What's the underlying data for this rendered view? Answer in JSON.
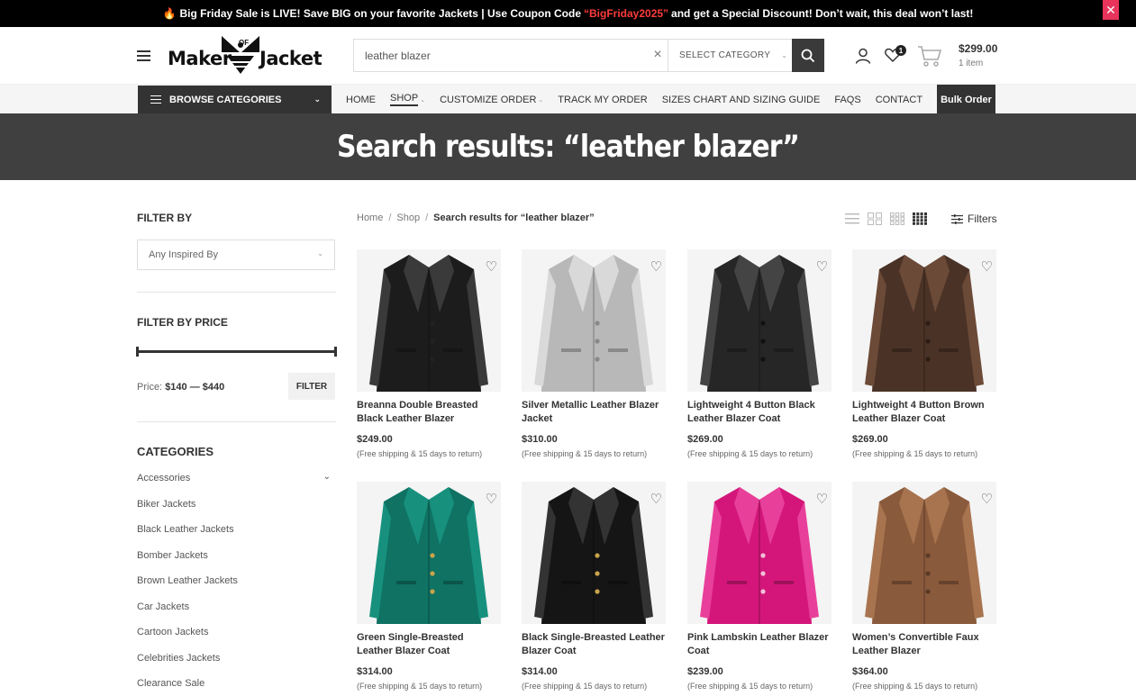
{
  "promo": {
    "icon": "fire-icon",
    "text_before": "Big Friday Sale is LIVE! Save BIG on your favorite Jackets | Use Coupon Code",
    "coupon": "“BigFriday2025”",
    "text_after": "and get a Special Discount! Don’t wait, this deal won’t last!",
    "coupon_color": "#ff3b3b"
  },
  "header": {
    "logo": {
      "word1": "Maker",
      "of": "OF",
      "word2": "Jacket"
    },
    "search": {
      "value": "leather blazer",
      "category": "SELECT CATEGORY"
    },
    "cart": {
      "total": "$299.00",
      "items": "1 item"
    },
    "wishlist_count": "1"
  },
  "nav": {
    "browse_label": "BROWSE CATEGORIES",
    "links": [
      {
        "label": "HOME"
      },
      {
        "label": "SHOP"
      },
      {
        "label": "CUSTOMIZE ORDER"
      },
      {
        "label": "TRACK MY ORDER"
      },
      {
        "label": "SIZES CHART AND SIZING GUIDE"
      },
      {
        "label": "FAQS"
      },
      {
        "label": "CONTACT"
      }
    ],
    "bulk_label": "Bulk Order"
  },
  "banner": {
    "title": "Search results: “leather blazer”"
  },
  "sidebar": {
    "filter_by": "FILTER BY",
    "inspired_placeholder": "Any Inspired By",
    "filter_by_price": "FILTER BY PRICE",
    "price_label": "Price:",
    "price_range": "$140 — $440",
    "filter_button": "FILTER",
    "categories_title": "CATEGORIES",
    "categories": [
      "Accessories",
      "Biker Jackets",
      "Black Leather Jackets",
      "Bomber Jackets",
      "Brown Leather Jackets",
      "Car Jackets",
      "Cartoon Jackets",
      "Celebrities Jackets",
      "Clearance Sale"
    ]
  },
  "breadcrumb": {
    "home": "Home",
    "shop": "Shop",
    "current": "Search results for “leather blazer”"
  },
  "toolbar": {
    "filters_label": "Filters"
  },
  "products": [
    {
      "name": "Breanna Double Breasted Black Leather Blazer",
      "price": "$249.00",
      "shipping": "(Free shipping & 15 days to return)",
      "color": "#1c1c1c",
      "accent": "#3a3a3a",
      "button_color": "#222"
    },
    {
      "name": "Silver Metallic Leather Blazer Jacket",
      "price": "$310.00",
      "shipping": "(Free shipping & 15 days to return)",
      "color": "#b8b8b8",
      "accent": "#d9d9d9",
      "button_color": "#888"
    },
    {
      "name": "Lightweight 4 Button Black Leather Blazer Coat",
      "price": "$269.00",
      "shipping": "(Free shipping & 15 days to return)",
      "color": "#262626",
      "accent": "#444",
      "button_color": "#111"
    },
    {
      "name": "Lightweight 4 Button Brown Leather Blazer Coat",
      "price": "$269.00",
      "shipping": "(Free shipping & 15 days to return)",
      "color": "#4a3226",
      "accent": "#6b4a38",
      "button_color": "#2d1d15"
    },
    {
      "name": "Green Single-Breasted Leather Blazer Coat",
      "price": "$314.00",
      "shipping": "(Free shipping & 15 days to return)",
      "color": "#0f7263",
      "accent": "#17917e",
      "button_color": "#c9a44a"
    },
    {
      "name": "Black Single-Breasted Leather Blazer Coat",
      "price": "$314.00",
      "shipping": "(Free shipping & 15 days to return)",
      "color": "#151515",
      "accent": "#333",
      "button_color": "#c9a44a"
    },
    {
      "name": "Pink Lambskin Leather Blazer Coat",
      "price": "$239.00",
      "shipping": "(Free shipping & 15 days to return)",
      "color": "#d4167a",
      "accent": "#e8409a",
      "button_color": "#f0c0d8"
    },
    {
      "name": "Women’s Convertible Faux Leather Blazer",
      "price": "$364.00",
      "shipping": "(Free shipping & 15 days to return)",
      "color": "#8a5a3c",
      "accent": "#a8744f",
      "button_color": "#5a3a25"
    }
  ]
}
